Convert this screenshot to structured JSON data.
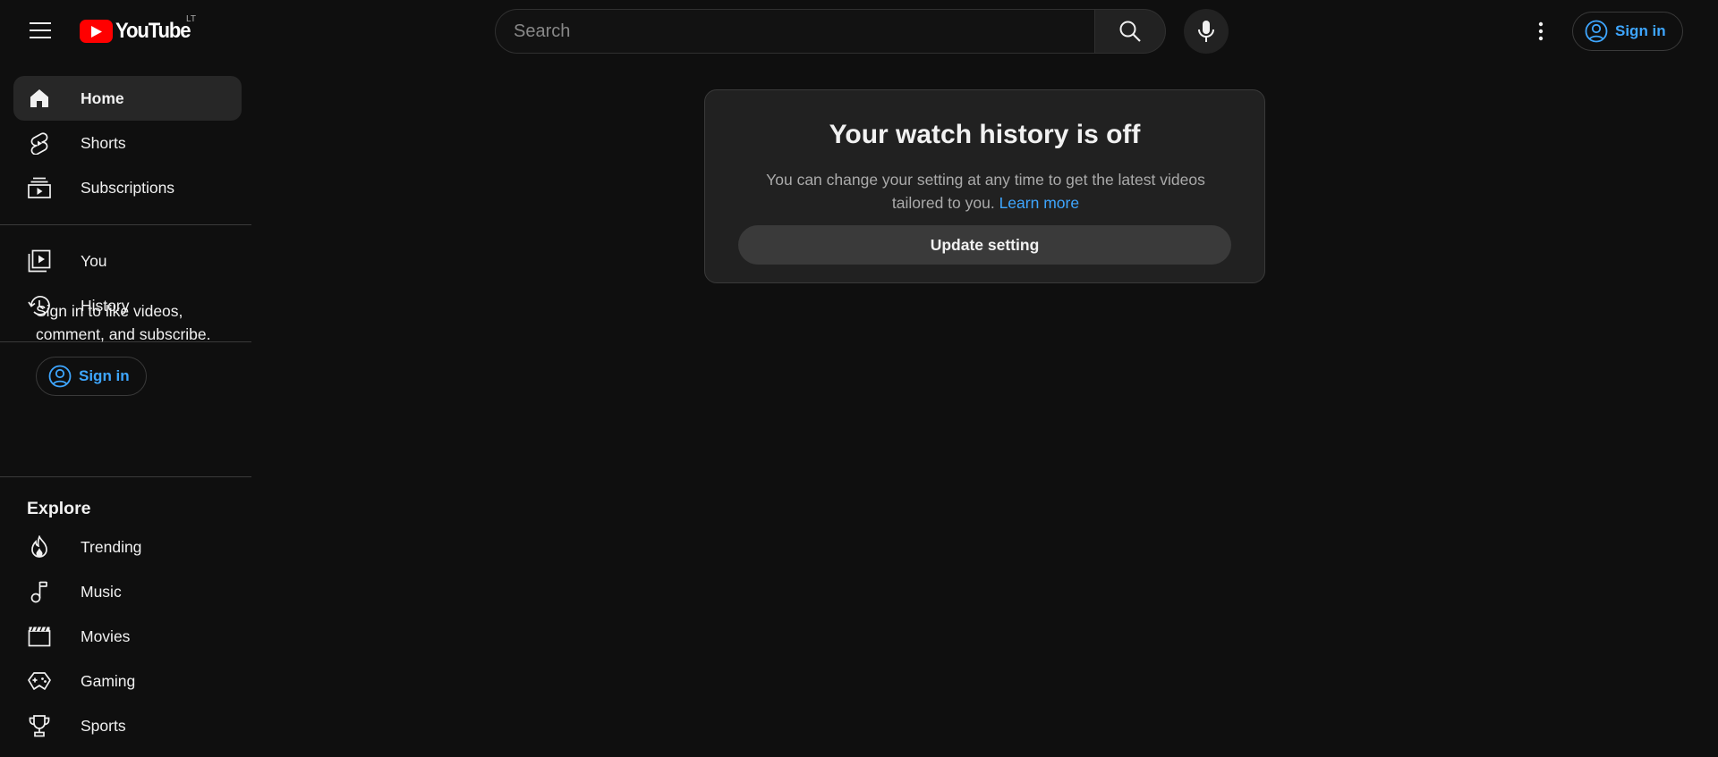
{
  "header": {
    "menu_icon": "hamburger-menu-icon",
    "logo_text": "YouTube",
    "country_code": "LT",
    "search": {
      "placeholder": "Search",
      "value": ""
    },
    "search_icon": "search-icon",
    "mic_icon": "microphone-icon",
    "more_icon": "more-vertical-icon",
    "signin_label": "Sign in"
  },
  "sidebar": {
    "primary": [
      {
        "label": "Home",
        "icon": "home-icon",
        "active": true
      },
      {
        "label": "Shorts",
        "icon": "shorts-icon"
      },
      {
        "label": "Subscriptions",
        "icon": "subscriptions-icon"
      }
    ],
    "you": [
      {
        "label": "You",
        "icon": "you-icon"
      },
      {
        "label": "History",
        "icon": "history-icon"
      }
    ],
    "signin_prompt": "Sign in to like videos, comment, and subscribe.",
    "signin_label": "Sign in",
    "explore_title": "Explore",
    "explore": [
      {
        "label": "Trending",
        "icon": "trending-icon"
      },
      {
        "label": "Music",
        "icon": "music-icon"
      },
      {
        "label": "Movies",
        "icon": "movies-icon"
      },
      {
        "label": "Gaming",
        "icon": "gaming-icon"
      },
      {
        "label": "Sports",
        "icon": "sports-icon"
      }
    ]
  },
  "main": {
    "card": {
      "title": "Your watch history is off",
      "description": "You can change your setting at any time to get the latest videos tailored to you.",
      "link": "Learn more",
      "button": "Update setting"
    }
  },
  "colors": {
    "background": "#0f0f0f",
    "card": "#212121",
    "accent_link": "#3ea6ff",
    "brand_red": "#ff0000"
  }
}
